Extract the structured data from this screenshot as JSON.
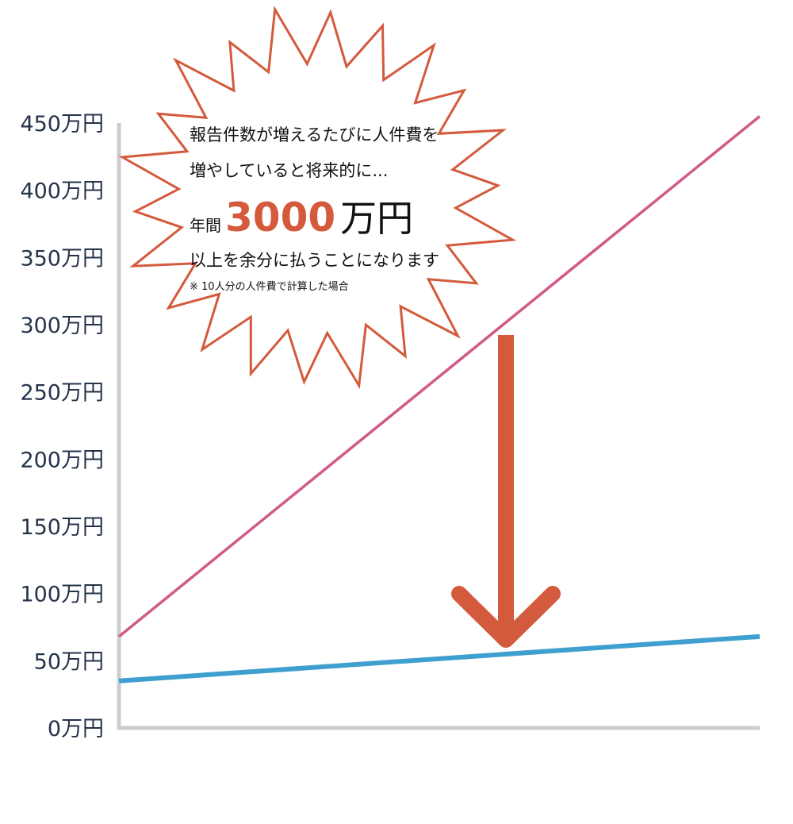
{
  "chart_data": {
    "type": "line",
    "title": "",
    "xlabel": "",
    "ylabel": "",
    "ylim": [
      0,
      450
    ],
    "y_ticks": [
      "0万円",
      "50万円",
      "100万円",
      "150万円",
      "200万円",
      "250万円",
      "300万円",
      "350万円",
      "400万円",
      "450万円"
    ],
    "x": [
      0,
      1
    ],
    "series": [
      {
        "color": "#d05a8a",
        "values": [
          68,
          455
        ]
      },
      {
        "color": "#3fa0cf",
        "values": [
          35,
          68
        ]
      }
    ],
    "grid": false,
    "legend": "none"
  },
  "callout": {
    "line1": "報告件数が増えるたびに人件費を",
    "line2": "増やしていると将来的に...",
    "prefix": "年間",
    "amount": "3000",
    "unit": "万円",
    "line4": "以上を余分に払うことになります",
    "note": "※ 10人分の人件費で計算した場合"
  },
  "colors": {
    "accent": "#d35a3c",
    "axis": "#cccccc",
    "tick_text": "#25334a"
  }
}
